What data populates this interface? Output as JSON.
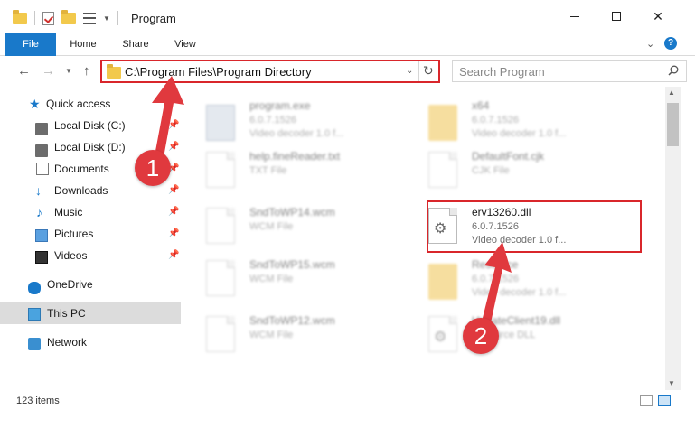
{
  "window": {
    "title": "Program",
    "minimize_icon": "minimize-icon",
    "maximize_icon": "maximize-icon",
    "close_glyph": "✕"
  },
  "ribbon": {
    "tabs": [
      {
        "label": "File"
      },
      {
        "label": "Home"
      },
      {
        "label": "Share"
      },
      {
        "label": "View"
      }
    ],
    "help_label": "?"
  },
  "address_bar": {
    "path": "C:\\Program Files\\Program Directory"
  },
  "search": {
    "placeholder": "Search Program"
  },
  "nav_pane": {
    "items": [
      {
        "label": "Quick access",
        "icon": "star-icon"
      },
      {
        "label": "Local Disk (C:)",
        "icon": "disk-icon",
        "pinned": true
      },
      {
        "label": "Local Disk (D:)",
        "icon": "disk-icon",
        "pinned": true
      },
      {
        "label": "Documents",
        "icon": "document-icon",
        "pinned": true
      },
      {
        "label": "Downloads",
        "icon": "download-icon",
        "pinned": true
      },
      {
        "label": "Music",
        "icon": "music-icon",
        "pinned": true
      },
      {
        "label": "Pictures",
        "icon": "picture-icon",
        "pinned": true
      },
      {
        "label": "Videos",
        "icon": "video-icon",
        "pinned": true
      },
      {
        "label": "OneDrive",
        "icon": "cloud-icon"
      },
      {
        "label": "This PC",
        "icon": "computer-icon",
        "selected": true
      },
      {
        "label": "Network",
        "icon": "network-icon"
      }
    ]
  },
  "files": [
    {
      "name": "program.exe",
      "line1": "6.0.7.1526",
      "line2": "Video decoder 1.0 f...",
      "icon": "exe-icon",
      "blurred": true
    },
    {
      "name": "x64",
      "line1": "6.0.7.1526",
      "line2": "Video decoder 1.0 f...",
      "icon": "folder-icon",
      "blurred": true
    },
    {
      "name": "help.fineReader.txt",
      "line1": "TXT File",
      "line2": "",
      "icon": "file-icon",
      "blurred": true
    },
    {
      "name": "DefaultFont.cjk",
      "line1": "CJK File",
      "line2": "",
      "icon": "file-icon",
      "blurred": true
    },
    {
      "name": "SndToWP14.wcm",
      "line1": "WCM File",
      "line2": "",
      "icon": "file-icon",
      "blurred": true
    },
    {
      "name": "erv13260.dll",
      "line1": "6.0.7.1526",
      "line2": "Video decoder 1.0 f...",
      "icon": "dll-gear-icon",
      "blurred": false
    },
    {
      "name": "SndToWP15.wcm",
      "line1": "WCM File",
      "line2": "",
      "icon": "file-icon",
      "blurred": true
    },
    {
      "name": "Resource",
      "line1": "6.0.7.1526",
      "line2": "Video decoder 1.0 f...",
      "icon": "folder-icon",
      "blurred": true
    },
    {
      "name": "SndToWP12.wcm",
      "line1": "WCM File",
      "line2": "",
      "icon": "file-icon",
      "blurred": true
    },
    {
      "name": "UpdateClient19.dll",
      "line1": "Resource DLL",
      "line2": "",
      "icon": "dll-gear-icon",
      "blurred": true
    }
  ],
  "status": {
    "item_count": "123 items"
  },
  "callouts": {
    "step1": "1",
    "step2": "2",
    "color": "#e0393e"
  },
  "colors": {
    "accent": "#1979ca",
    "highlight": "#d9262b"
  }
}
